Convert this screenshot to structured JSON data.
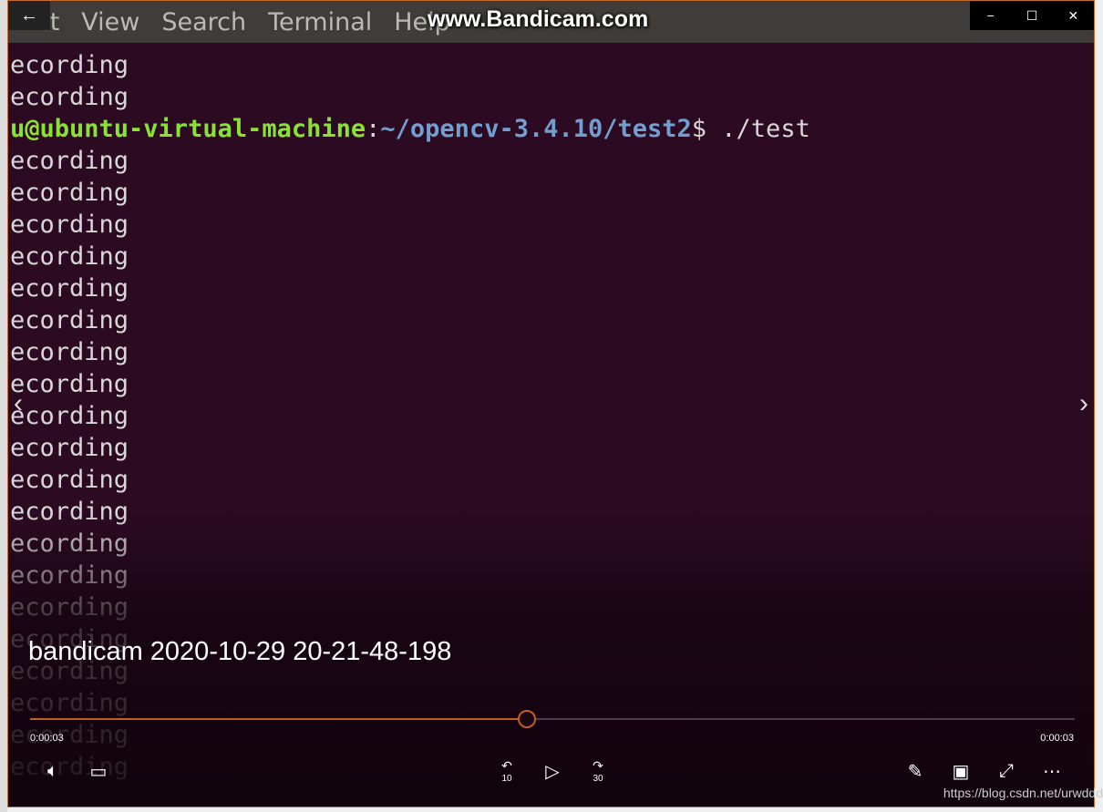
{
  "watermark": "www.Bandicam.com",
  "menu": [
    "Edit",
    "View",
    "Search",
    "Terminal",
    "Help"
  ],
  "window_controls": {
    "back": "←",
    "minimize": "−",
    "maximize": "☐",
    "close": "✕"
  },
  "terminal": {
    "lines_before": [
      "ecording",
      "ecording"
    ],
    "prompt_user": "u@ubuntu-virtual-machine",
    "prompt_sep": ":",
    "prompt_path": "~/opencv-3.4.10/test2",
    "prompt_cmd": "$ ./test",
    "line_text": "ecording",
    "lines_after_count": 20
  },
  "video": {
    "title": "bandicam 2020-10-29 20-21-48-198",
    "elapsed": "0:00:03",
    "duration": "0:00:03",
    "progress": 0.476,
    "accent": "#c0601c"
  },
  "controls": {
    "skip_back": "10",
    "skip_forward": "30"
  },
  "footer_watermark": "https://blog.csdn.net/urwddd"
}
